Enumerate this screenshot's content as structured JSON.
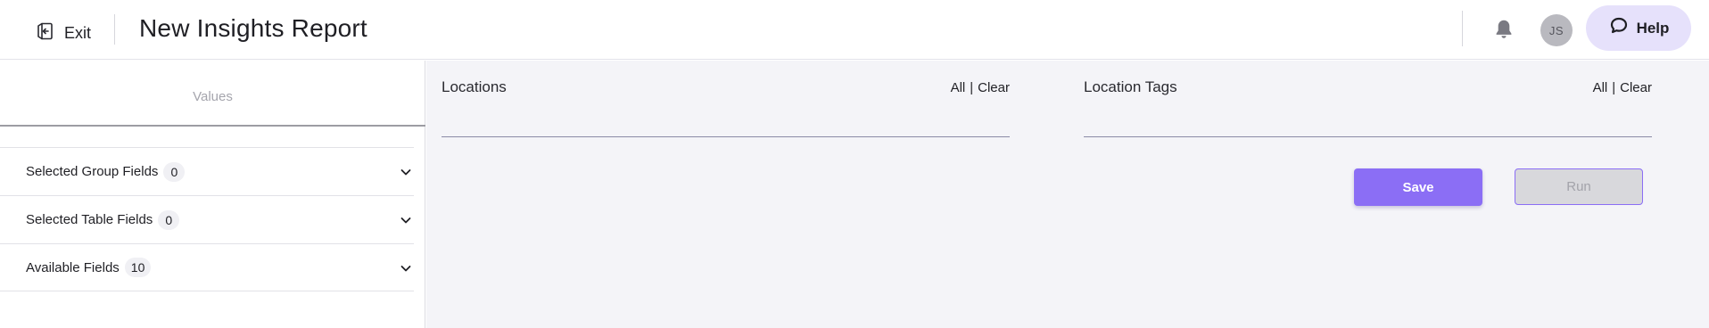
{
  "header": {
    "exit_label": "Exit",
    "title": "New Insights Report",
    "avatar_initials": "JS",
    "help_label": "Help",
    "icons": {
      "exit": "exit-icon",
      "notifications": "bell-icon",
      "help": "chat-bubble-icon"
    }
  },
  "sidebar": {
    "values_label": "Values",
    "sections": [
      {
        "label": "Selected Group Fields",
        "count": "0"
      },
      {
        "label": "Selected Table Fields",
        "count": "0"
      },
      {
        "label": "Available Fields",
        "count": "10"
      }
    ]
  },
  "filters": {
    "locations": {
      "title": "Locations",
      "all_label": "All",
      "separator": "|",
      "clear_label": "Clear",
      "value": ""
    },
    "location_tags": {
      "title": "Location Tags",
      "all_label": "All",
      "separator": "|",
      "clear_label": "Clear",
      "value": ""
    }
  },
  "actions": {
    "save_label": "Save",
    "run_label": "Run",
    "run_disabled": true
  },
  "colors": {
    "accent": "#8b6ef5",
    "help_bg": "#e6e1fb",
    "main_bg": "#f4f4f8"
  }
}
